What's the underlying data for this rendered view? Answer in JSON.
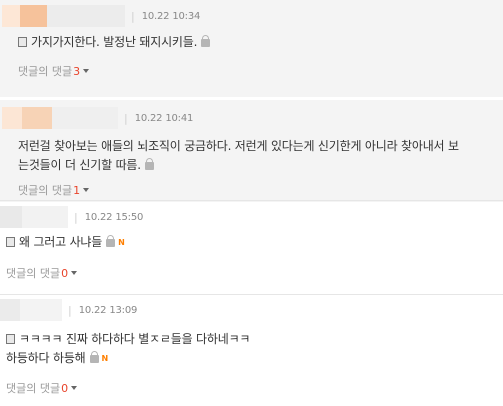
{
  "comments": [
    {
      "time": "10.22 10:34",
      "text": "가지가지한다. 발정난 돼지시키들.",
      "reply_label": "댓글의 댓글",
      "reply_count": "3",
      "has_new": false
    },
    {
      "time": "10.22 10:41",
      "text_line1": "저런걸 찾아보는 애들의 뇌조직이 궁금하다. 저런게 있다는게 신기한게 아니라 찾아내서 보",
      "text_line2": "는것들이 더 신기할 따름.",
      "reply_label": "댓글의 댓글",
      "reply_count": "1",
      "has_new": false
    },
    {
      "time": "10.22 15:50",
      "text": "왜 그러고 사냐들",
      "new_badge": "N",
      "reply_label": "댓글의 댓글",
      "reply_count": "0",
      "has_new": true
    },
    {
      "time": "10.22 13:09",
      "text_line1": "ㅋㅋㅋㅋ 진짜 하다하다 별ㅈㄹ들을 다하네ㅋㅋ",
      "text_line2": "하등하다 하등해",
      "new_badge": "N",
      "reply_label": "댓글의 댓글",
      "reply_count": "0",
      "has_new": true
    }
  ],
  "colors": {
    "reply_count": "#e8442b",
    "new_badge": "#ff7f00",
    "highlight_bg": "#f4f4f4"
  },
  "icons": [
    "memo-icon",
    "lock-icon",
    "chevron-down-icon",
    "new-badge"
  ]
}
